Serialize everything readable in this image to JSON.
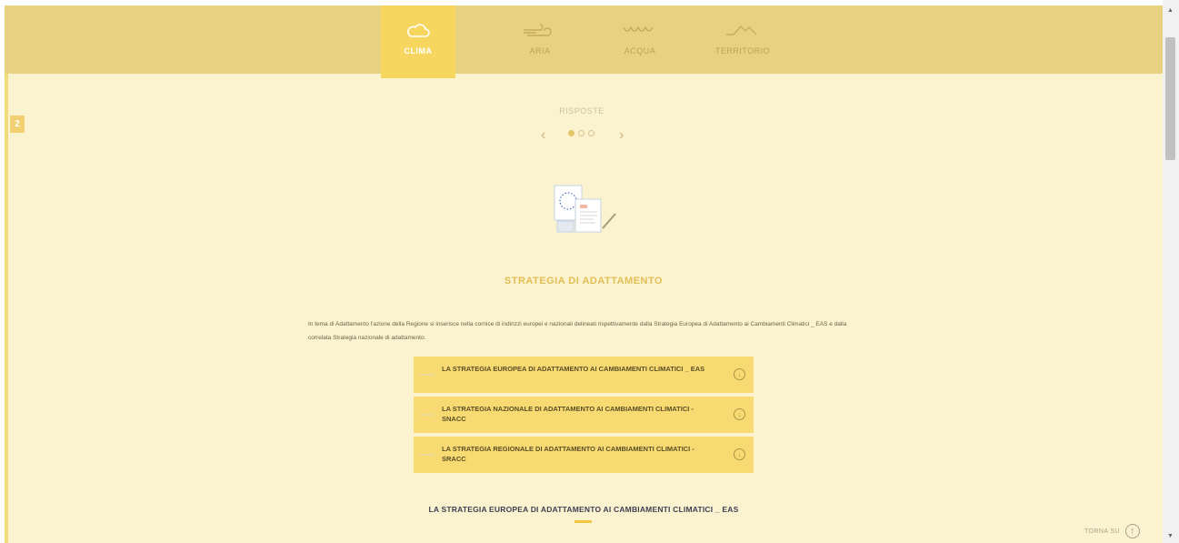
{
  "nav": {
    "items": [
      {
        "label": "CLIMA",
        "icon": "cloud-icon",
        "active": true
      },
      {
        "label": "ARIA",
        "icon": "wind-icon",
        "active": false
      },
      {
        "label": "ACQUA",
        "icon": "water-icon",
        "active": false
      },
      {
        "label": "TERRITORIO",
        "icon": "mountain-icon",
        "active": false
      }
    ]
  },
  "side_tab": {
    "label": "2"
  },
  "carousel": {
    "label": "RISPOSTE",
    "prev": "‹",
    "next": "›",
    "dots": 3,
    "active_dot": 1
  },
  "section": {
    "title": "STRATEGIA DI ADATTAMENTO",
    "intro": "In tema di Adattamento l'azione della Regione si inserisce nella cornice di indirizzi europei e nazionali delineati rispettivamente dalla Strategia Europea di Adattamento ai Cambiamenti Climatici _ EAS e dalla correlata Strategia nazionale di adattamento."
  },
  "accordion": {
    "items": [
      {
        "label": "LA STRATEGIA EUROPEA DI ADATTAMENTO AI CAMBIAMENTI CLIMATICI _ EAS"
      },
      {
        "label": "LA STRATEGIA NAZIONALE DI ADATTAMENTO AI CAMBIAMENTI CLIMATICI - SNACC"
      },
      {
        "label": "LA STRATEGIA REGIONALE DI ADATTAMENTO AI CAMBIAMENTI CLIMATICI - SRACC"
      }
    ]
  },
  "bottom": {
    "title": "LA STRATEGIA EUROPEA DI ADATTAMENTO AI CAMBIAMENTI CLIMATICI _ EAS"
  },
  "back_to_top": {
    "label": "TORNA SU"
  },
  "colors": {
    "page_bg": "#fbf3cf",
    "nav_bg": "#e6d281",
    "nav_active": "#f7d660",
    "accordion_bg": "#f7da72",
    "accent": "#e1bf55"
  }
}
